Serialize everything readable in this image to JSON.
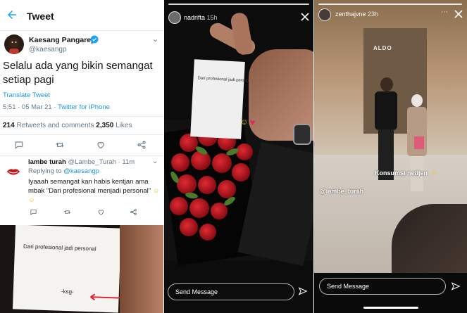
{
  "tweet": {
    "header_title": "Tweet",
    "author_name": "Kaesang Pangarep",
    "author_handle": "@kaesangp",
    "text": "Selalu ada yang bikin semangat setiap pagi",
    "translate_label": "Translate Tweet",
    "time": "5:51 · 05 Mar 21 · ",
    "source": "Twitter for iPhone",
    "retweets_count": "214",
    "retweets_label": " Retweets and comments  ",
    "likes_count": "2,350",
    "likes_label": " Likes"
  },
  "reply": {
    "name": "lambe turah",
    "handle_time": " @Lambe_Turah · 11m",
    "replying_prefix": "Replying to ",
    "replying_to": "@kaesangp",
    "text": "Iyaaah semangat kan habis kentjan ama mbak \"Dari profesional menjadi personal\"",
    "image_paper_text": "Dari profesional jadi personal",
    "image_signature": "-ksg-"
  },
  "story_left": {
    "username": "nadrifta",
    "time": " 15h",
    "paper_text": "Dari profesional jadi personal",
    "send_placeholder": "Send Message"
  },
  "story_right": {
    "username": "zenthajvne",
    "time": " 23h",
    "store_sign": "ALDO",
    "caption": "Konsumsi netijen",
    "mention": "@lambe_turah",
    "send_placeholder": "Send Message"
  },
  "icons": {
    "back": "arrow-left-icon",
    "verified": "verified-badge-icon",
    "reply": "comment-icon",
    "retweet": "retweet-icon",
    "like": "heart-icon",
    "share": "share-icon",
    "close": "close-icon",
    "send": "send-icon"
  },
  "colors": {
    "twitter_blue": "#1da1f2",
    "link_blue": "#1b95e0",
    "muted_gray": "#657786",
    "arrow_red": "#e0243c"
  }
}
